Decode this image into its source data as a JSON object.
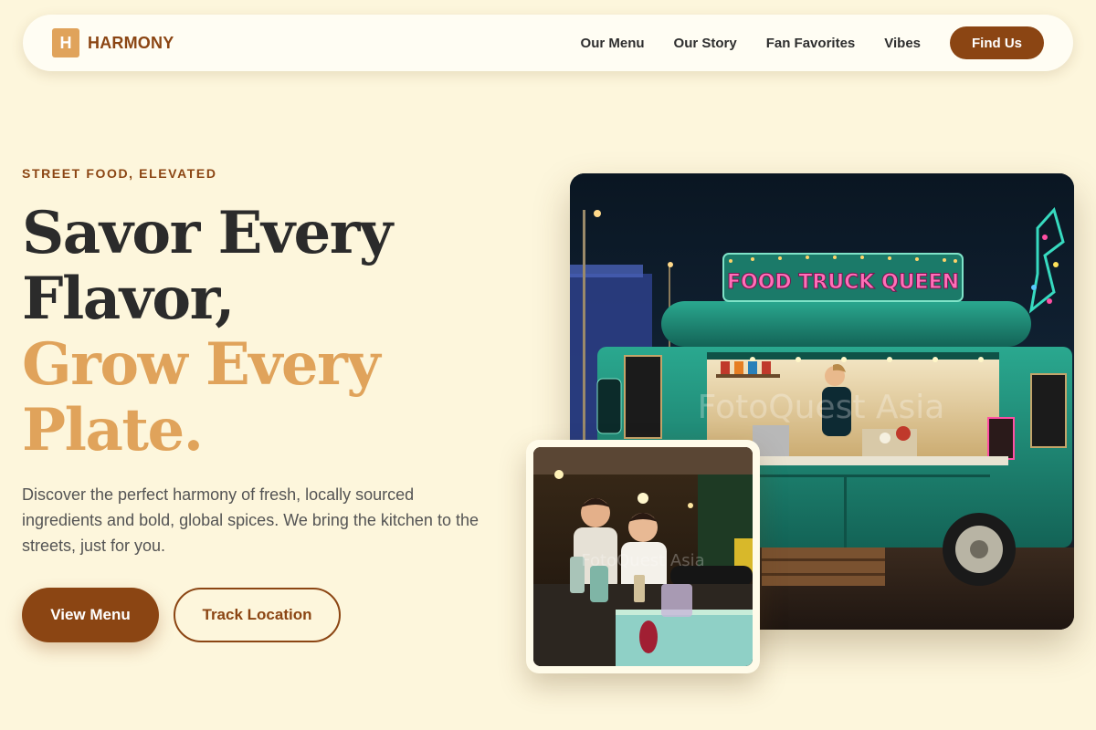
{
  "brand": {
    "mark": "H",
    "name": "HARMONY"
  },
  "nav": {
    "links": [
      "Our Menu",
      "Our Story",
      "Fan Favorites",
      "Vibes"
    ],
    "cta": "Find Us"
  },
  "hero": {
    "eyebrow": "STREET FOOD, ELEVATED",
    "headline": [
      "Savor Every",
      "Flavor,",
      "Grow Every",
      "Plate."
    ],
    "lede": "Discover the perfect harmony of fresh, locally sourced ingredients and bold, global spices. We bring the kitchen to the streets, just for you.",
    "primary_button": "View Menu",
    "secondary_button": "Track Location"
  },
  "images": {
    "main": {
      "sign_text": "FOOD TRUCK QUEEN",
      "watermark": "FotoQuest Asia"
    },
    "small": {
      "watermark": "FotoQuest Asia"
    }
  },
  "colors": {
    "background": "#fdf6dc",
    "brand_brown": "#8b4513",
    "accent_gold": "#e0a35b",
    "truck_teal": "#1f8a76"
  }
}
